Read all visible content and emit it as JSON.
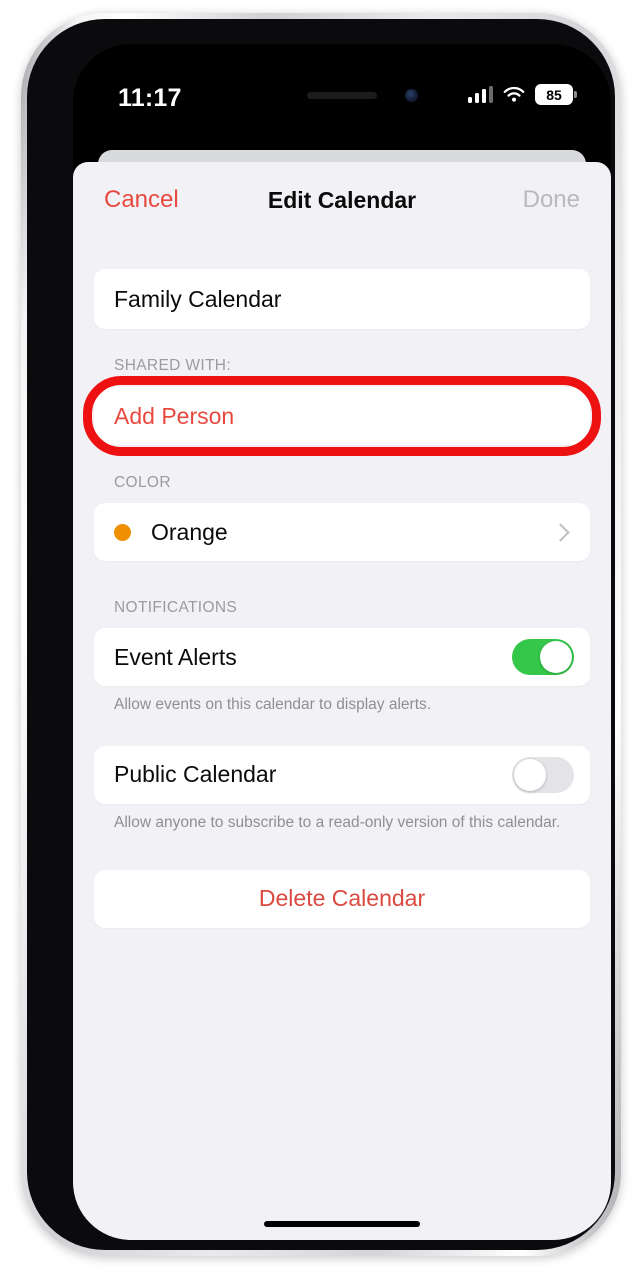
{
  "status_bar": {
    "time": "11:17",
    "cellular_icon": "cellular-signal-icon",
    "wifi_icon": "wifi-icon",
    "battery_level": "85"
  },
  "navbar": {
    "cancel_label": "Cancel",
    "title": "Edit Calendar",
    "done_label": "Done"
  },
  "calendar_name": {
    "value": "Family Calendar",
    "placeholder": "Calendar Name"
  },
  "shared_with": {
    "section_label": "SHARED WITH:",
    "add_person_label": "Add Person"
  },
  "color": {
    "section_label": "COLOR",
    "selected": "Orange",
    "swatch_hex": "#F09000",
    "chevron_icon": "chevron-right-icon"
  },
  "notifications": {
    "section_label": "NOTIFICATIONS",
    "event_alerts": {
      "label": "Event Alerts",
      "state": "on",
      "footnote": "Allow events on this calendar to display alerts."
    },
    "public_calendar": {
      "label": "Public Calendar",
      "state": "off",
      "footnote": "Allow anyone to subscribe to a read-only version of this calendar."
    }
  },
  "delete": {
    "label": "Delete Calendar"
  },
  "annotation": {
    "type": "rounded-rect-outline",
    "target": "Add Person",
    "color_hex": "#EE1111"
  },
  "theme": {
    "accent_red": "#E8493F",
    "toggle_on_green": "#34C749",
    "background_gray": "#F2F2F6",
    "card_white": "#FFFFFF",
    "secondary_text": "#8E8E95"
  }
}
